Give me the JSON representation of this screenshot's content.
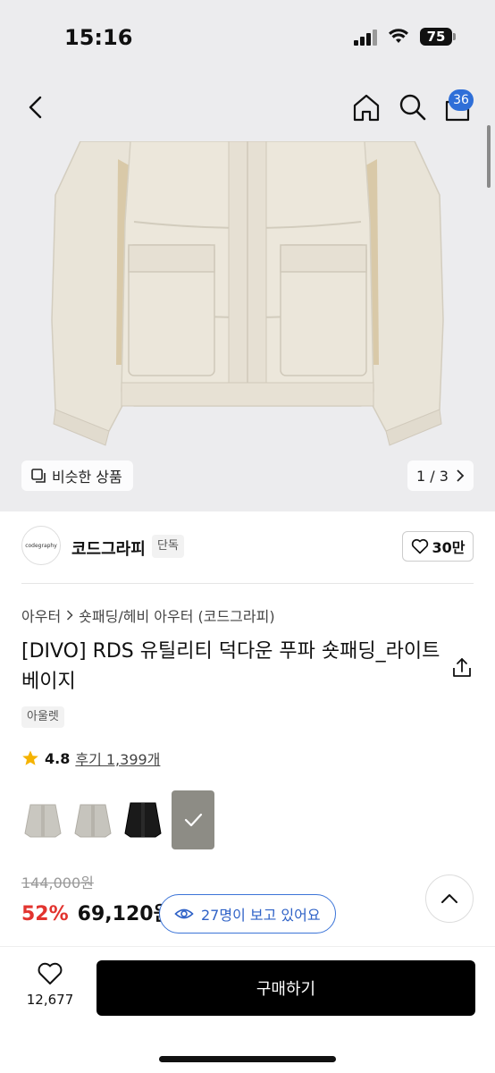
{
  "status_bar": {
    "time": "15:16",
    "battery": "75"
  },
  "nav": {
    "cart_count": "36"
  },
  "gallery": {
    "similar_label": "비슷한 상품",
    "pager": "1 / 3"
  },
  "brand": {
    "logo_text": "codegraphy",
    "name": "코드그라피",
    "tag": "단독",
    "likes": "30만"
  },
  "breadcrumb": {
    "level1": "아우터",
    "level2": "숏패딩/헤비 아우터 (코드그라피)"
  },
  "product": {
    "title": "[DIVO] RDS 유틸리티 덕다운 푸파 숏패딩_라이트베이지",
    "badge": "아울렛",
    "rating": "4.8",
    "review_text": "후기 1,399개",
    "original_price": "144,000원",
    "discount": "52%",
    "sale_price": "69,120원"
  },
  "swatches": [
    {
      "color": "light-gray",
      "selected": false
    },
    {
      "color": "light-gray",
      "selected": false
    },
    {
      "color": "black",
      "selected": false
    },
    {
      "color": "gray-beige",
      "selected": true
    }
  ],
  "viewers": {
    "text": "27명이 보고 있어요"
  },
  "bottom": {
    "wish_count": "12,677",
    "buy_label": "구매하기"
  },
  "colors": {
    "accent_blue": "#2f6fd8",
    "discount_red": "#e2342f",
    "buy_button": "#000000",
    "star": "#f5b301"
  },
  "icons": [
    "back-arrow-icon",
    "home-icon",
    "search-icon",
    "cart-icon",
    "similar-items-icon",
    "chevron-right-icon",
    "heart-icon",
    "share-icon",
    "star-icon",
    "check-icon",
    "eye-icon",
    "chevron-up-icon"
  ]
}
